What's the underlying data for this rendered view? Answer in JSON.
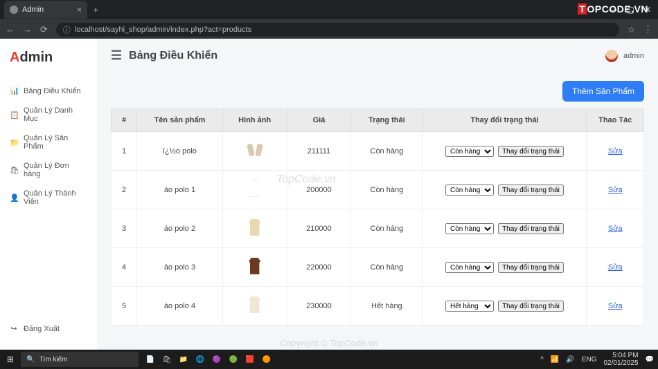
{
  "browser": {
    "tab_title": "Admin",
    "url": "localhost/sayhi_shop/admin/index.php?act=products"
  },
  "sidebar": {
    "logo_prefix": "A",
    "logo_rest": "dmin",
    "items": [
      {
        "icon": "📊",
        "label": "Bảng Điều Khiển"
      },
      {
        "icon": "📋",
        "label": "Quản Lý Danh Mục"
      },
      {
        "icon": "📁",
        "label": "Quản Lý Sản Phẩm"
      },
      {
        "icon": "🛍",
        "label": "Quản Lý Đơn hàng"
      },
      {
        "icon": "👤",
        "label": "Quản Lý Thành Viên"
      }
    ],
    "logout": {
      "icon": "↪",
      "label": "Đăng Xuất"
    }
  },
  "header": {
    "page_title": "Bảng Điều Khiển",
    "user_label": "admin"
  },
  "buttons": {
    "add_product": "Thêm Sản Phẩm",
    "change_status": "Thay đổi trạng thái"
  },
  "table": {
    "headers": [
      "#",
      "Tên sản phẩm",
      "Hình ảnh",
      "Giá",
      "Trạng thái",
      "Thay đổi trạng thái",
      "Thao Tác"
    ],
    "status_options": [
      "Còn hàng",
      "Hết hàng"
    ],
    "action_label": "Sửa",
    "rows": [
      {
        "num": "1",
        "name": "ï¿½o polo",
        "thumb": "sleeves",
        "price": "211111",
        "status": "Còn hàng",
        "select": "Còn hàng"
      },
      {
        "num": "2",
        "name": "áo polo 1",
        "thumb": "white",
        "price": "200000",
        "status": "Còn hàng",
        "select": "Còn hàng"
      },
      {
        "num": "3",
        "name": "áo polo 2",
        "thumb": "cream",
        "price": "210000",
        "status": "Còn hàng",
        "select": "Còn hàng"
      },
      {
        "num": "4",
        "name": "áo polo 3",
        "thumb": "brown",
        "price": "220000",
        "status": "Còn hàng",
        "select": "Còn hàng"
      },
      {
        "num": "5",
        "name": "áo polo 4",
        "thumb": "beige",
        "price": "230000",
        "status": "Hết hàng",
        "select": "Hết hàng"
      }
    ]
  },
  "taskbar": {
    "search_placeholder": "Tìm kiếm",
    "time": "5:04 PM",
    "date": "02/01/2025",
    "lang": "ENG"
  },
  "watermark": {
    "brand_t": "T",
    "brand_rest": "OPCODE.VN",
    "center": "TopCode.vn",
    "copyright": "Copyright © TopCode.vn"
  }
}
